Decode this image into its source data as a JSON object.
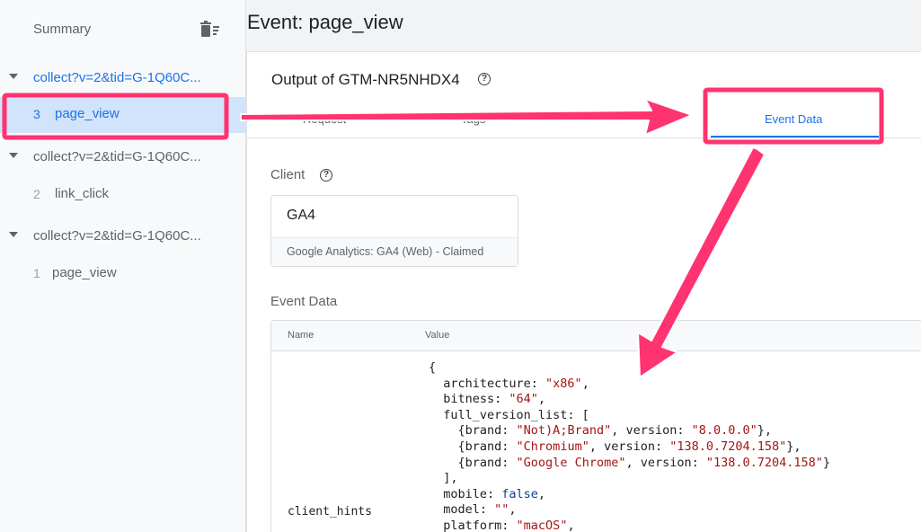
{
  "sidebar": {
    "summary": "Summary",
    "requests": [
      {
        "label": "collect?v=2&tid=G-1Q60C...",
        "events": [
          {
            "num": "3",
            "name": "page_view"
          }
        ]
      },
      {
        "label": "collect?v=2&tid=G-1Q60C...",
        "events": [
          {
            "num": "2",
            "name": "link_click"
          }
        ]
      },
      {
        "label": "collect?v=2&tid=G-1Q60C...",
        "events": [
          {
            "num": "1",
            "name": "page_view"
          }
        ]
      }
    ]
  },
  "main": {
    "title": "Event: page_view",
    "output_title": "Output of GTM-NR5NHDX4",
    "tabs": [
      "Request",
      "Tags",
      "Event Data"
    ],
    "active_tab": "Event Data",
    "client_label": "Client",
    "client_name": "GA4",
    "client_desc": "Google Analytics: GA4 (Web) - Claimed",
    "event_data_label": "Event Data",
    "table": {
      "col_name": "Name",
      "col_value": "Value",
      "rows": [
        {
          "name": "client_hints",
          "value_lines": [
            [
              {
                "t": "{"
              }
            ],
            [
              {
                "t": "  architecture: "
              },
              {
                "t": "\"x86\"",
                "c": "s"
              },
              {
                "t": ","
              }
            ],
            [
              {
                "t": "  bitness: "
              },
              {
                "t": "\"64\"",
                "c": "s"
              },
              {
                "t": ","
              }
            ],
            [
              {
                "t": "  full_version_list: ["
              }
            ],
            [
              {
                "t": "    {brand: "
              },
              {
                "t": "\"Not)A;Brand\"",
                "c": "s"
              },
              {
                "t": ", version: "
              },
              {
                "t": "\"8.0.0.0\"",
                "c": "s"
              },
              {
                "t": "},"
              }
            ],
            [
              {
                "t": "    {brand: "
              },
              {
                "t": "\"Chromium\"",
                "c": "s"
              },
              {
                "t": ", version: "
              },
              {
                "t": "\"138.0.7204.158\"",
                "c": "s"
              },
              {
                "t": "},"
              }
            ],
            [
              {
                "t": "    {brand: "
              },
              {
                "t": "\"Google Chrome\"",
                "c": "s"
              },
              {
                "t": ", version: "
              },
              {
                "t": "\"138.0.7204.158\"",
                "c": "s"
              },
              {
                "t": "}"
              }
            ],
            [
              {
                "t": "  ],"
              }
            ],
            [
              {
                "t": "  mobile: "
              },
              {
                "t": "false",
                "c": "b"
              },
              {
                "t": ","
              }
            ],
            [
              {
                "t": "  model: "
              },
              {
                "t": "\"\"",
                "c": "s"
              },
              {
                "t": ","
              }
            ],
            [
              {
                "t": "  platform: "
              },
              {
                "t": "\"macOS\"",
                "c": "s"
              },
              {
                "t": ","
              }
            ]
          ]
        }
      ]
    }
  },
  "colors": {
    "accent": "#1a73e8",
    "highlight": "#ff3370",
    "string": "#a31515"
  }
}
